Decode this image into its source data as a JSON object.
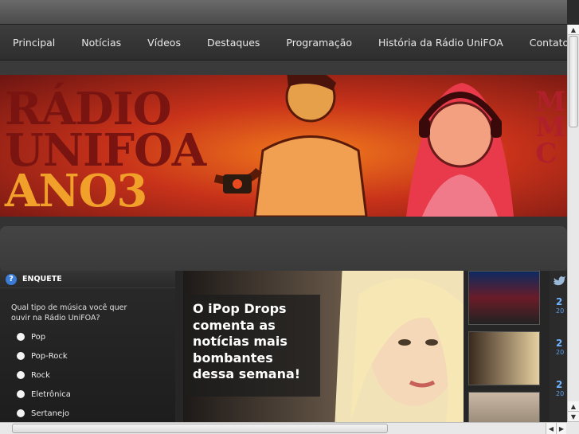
{
  "nav": {
    "items": [
      "Principal",
      "Notícias",
      "Vídeos",
      "Destaques",
      "Programação",
      "História da Rádio UniFOA",
      "Contato"
    ]
  },
  "banner": {
    "line1": "RÁDIO",
    "line2": "UNIFOA",
    "line3": "ANO3",
    "right_text": "M\nM\nC"
  },
  "poll": {
    "title": "ENQUETE",
    "icon": "question-icon",
    "question": "Qual tipo de música você quer ouvir na Rádio UniFOA?",
    "options": [
      "Pop",
      "Pop-Rock",
      "Rock",
      "Eletrônica",
      "Sertanejo"
    ]
  },
  "feature": {
    "headline_lines": [
      "O iPop Drops",
      "comenta as",
      "notícias mais",
      "bombantes",
      "dessa semana!"
    ]
  },
  "twitter": {
    "icon": "twitter-bird-icon",
    "entries": [
      {
        "day": "2",
        "sub": "20"
      },
      {
        "day": "2",
        "sub": "20"
      },
      {
        "day": "2",
        "sub": "20"
      }
    ]
  },
  "colors": {
    "accent_blue": "#3a7bd5",
    "banner_orange": "#f07a1c",
    "banner_red": "#c8321a"
  }
}
